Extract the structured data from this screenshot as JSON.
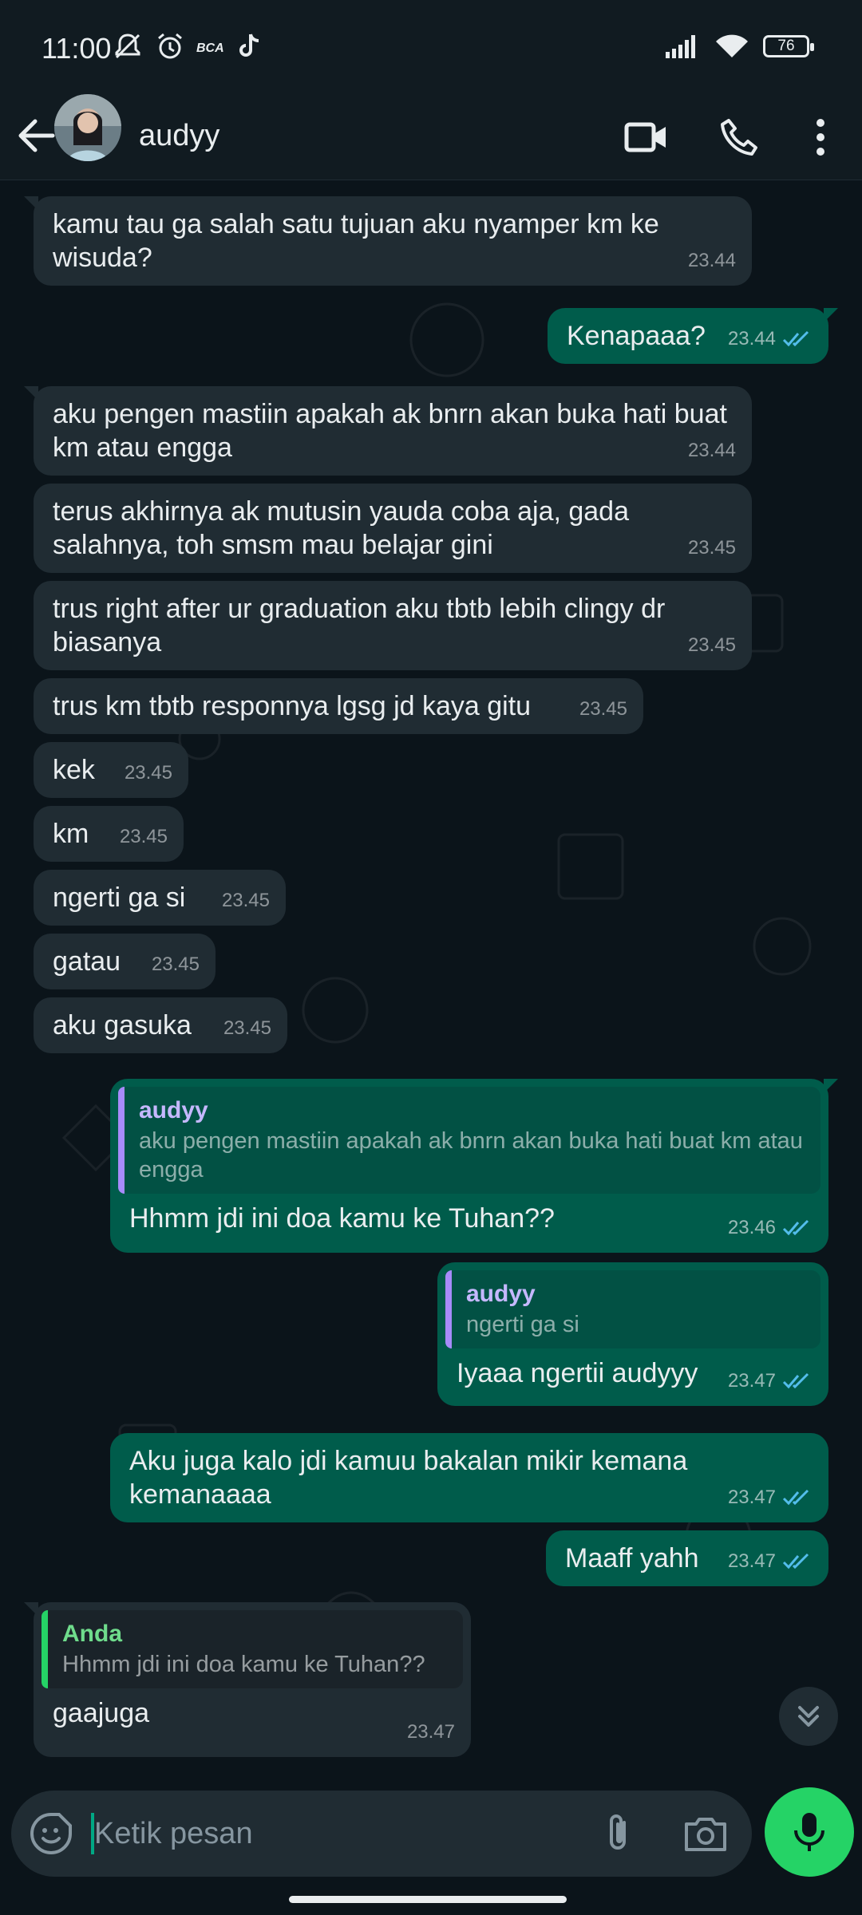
{
  "status_bar": {
    "time": "11:00",
    "battery": "76"
  },
  "header": {
    "contact_name": "audyy"
  },
  "messages": [
    {
      "text": "kamu tau ga salah satu tujuan aku nyamper km ke wisuda?",
      "time": "23.44"
    },
    {
      "text": "Kenapaaa?",
      "time": "23.44"
    },
    {
      "text": "aku pengen mastiin apakah ak bnrn akan buka hati buat km atau engga",
      "time": "23.44"
    },
    {
      "text": "terus akhirnya ak mutusin yauda coba aja, gada salahnya, toh smsm mau belajar gini",
      "time": "23.45"
    },
    {
      "text": "trus right after ur graduation aku tbtb lebih clingy dr biasanya",
      "time": "23.45"
    },
    {
      "text": "trus km tbtb responnya lgsg jd kaya gitu",
      "time": "23.45"
    },
    {
      "text": "kek",
      "time": "23.45"
    },
    {
      "text": "km",
      "time": "23.45"
    },
    {
      "text": "ngerti ga si",
      "time": "23.45"
    },
    {
      "text": "gatau",
      "time": "23.45"
    },
    {
      "text": "aku gasuka",
      "time": "23.45"
    },
    {
      "quote_name": "audyy",
      "quote_text": "aku pengen mastiin apakah ak bnrn akan buka hati buat km atau engga",
      "text": "Hhmm jdi ini doa kamu ke Tuhan??",
      "time": "23.46"
    },
    {
      "quote_name": "audyy",
      "quote_text": "ngerti ga si",
      "text": "Iyaaa ngertii audyyy",
      "time": "23.47"
    },
    {
      "text": "Aku juga kalo jdi kamuu bakalan mikir kemana kemanaaaa",
      "time": "23.47"
    },
    {
      "text": "Maaff yahh",
      "time": "23.47"
    },
    {
      "quote_name": "Anda",
      "quote_text": "Hhmm jdi ini doa kamu ke Tuhan??",
      "text": "gaajuga",
      "time": "23.47"
    }
  ],
  "input": {
    "placeholder": "Ketik pesan"
  },
  "colors": {
    "incoming": "#202c33",
    "outgoing": "#005c4b",
    "accent": "#25d366",
    "read_ticks": "#53bdeb"
  }
}
